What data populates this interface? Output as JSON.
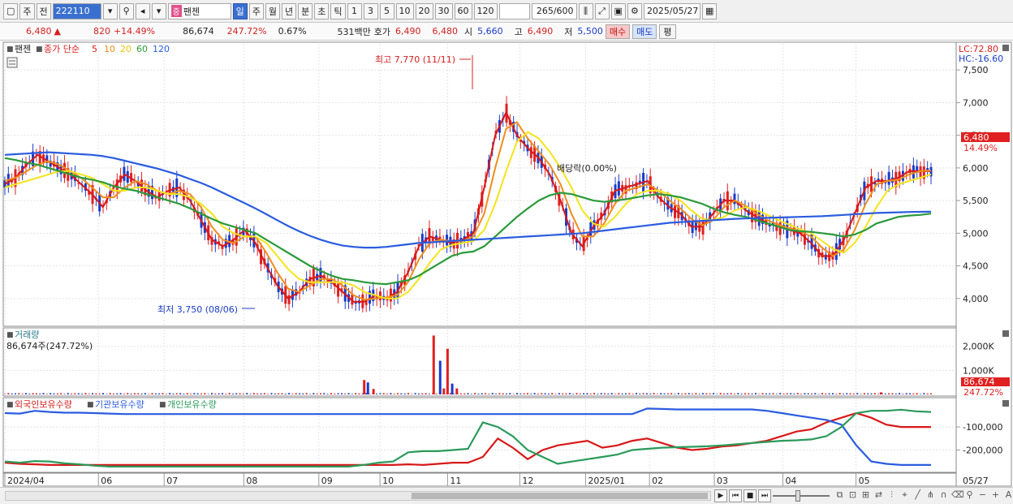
{
  "toolbar": {
    "market": "주",
    "period_label": "전",
    "code": "222110",
    "tag": "중",
    "name": "팬젠",
    "periods": [
      "일",
      "주",
      "월",
      "년",
      "분",
      "초",
      "틱"
    ],
    "active_period": "일",
    "minutes": [
      "1",
      "3",
      "5",
      "10",
      "20",
      "30",
      "60",
      "120"
    ],
    "count": "265",
    "count_total": "/600",
    "date": "2025/05/27"
  },
  "infobar": {
    "price": "6,480",
    "change_arrow": "▲",
    "change": "820",
    "change_pct": "+14.49%",
    "volume": "86,674",
    "volume_ratio": "247.72%",
    "turnover": "0.67%",
    "amount": "531백만",
    "quote_label": "호가",
    "ask": "6,490",
    "bid": "6,480",
    "open_label": "시",
    "open": "5,660",
    "high_label": "고",
    "high": "6,490",
    "low_label": "저",
    "low": "5,500",
    "buy_btn": "매수",
    "sell_btn": "매도",
    "eval_btn": "평"
  },
  "price_panel": {
    "legend": {
      "name": "팬젠",
      "label": "종가 단순",
      "ma": [
        "5",
        "10",
        "20",
        "60",
        "120"
      ]
    },
    "lc": "LC:72.80",
    "hc": "HC:-16.60",
    "current_price": "6,480",
    "current_pct": "14.49%",
    "high_annotation": "최고 7,770 (11/11)",
    "low_annotation": "최저 3,750 (08/06)",
    "dividend_annotation": "배당락(0.00%)",
    "colors": {
      "ma5": "#d81818",
      "ma10": "#f08c1c",
      "ma20": "#f4e41c",
      "ma60": "#2a9a3a",
      "ma120": "#2a5ce0",
      "up": "#e02020",
      "down": "#1a3cc8"
    }
  },
  "volume_panel": {
    "title": "거래량",
    "value": "86,674주(247.72%)",
    "current": "86,674",
    "current_pct": "247.72%"
  },
  "holding_panel": {
    "legend": [
      "외국인보유수량",
      "기관보유수량",
      "개인보유수량"
    ],
    "colors": [
      "#d81818",
      "#2a5ce0",
      "#2a9a5a"
    ]
  },
  "x_axis_labels": [
    "2024/04",
    "06",
    "07",
    "08",
    "09",
    "10",
    "11",
    "12",
    "2025/01",
    "02",
    "03",
    "04",
    "05",
    "05/27"
  ],
  "chart_data": [
    {
      "type": "line",
      "title": "",
      "ylim": [
        3600,
        7900
      ],
      "y_ticks": [
        4000,
        4500,
        5000,
        5500,
        6000,
        6500,
        7000,
        7500
      ],
      "y_tick_labels": [
        "4,000",
        "4,500",
        "5,000",
        "5,500",
        "6,000",
        "6,500",
        "7,000",
        "7,500"
      ],
      "x_ticks": [
        {
          "label": "2024/04",
          "pos": 0.0
        },
        {
          "label": "06",
          "pos": 0.101
        },
        {
          "label": "07",
          "pos": 0.172
        },
        {
          "label": "08",
          "pos": 0.258
        },
        {
          "label": "09",
          "pos": 0.339
        },
        {
          "label": "10",
          "pos": 0.405
        },
        {
          "label": "11",
          "pos": 0.478
        },
        {
          "label": "12",
          "pos": 0.556
        },
        {
          "label": "2025/01",
          "pos": 0.627
        },
        {
          "label": "02",
          "pos": 0.696
        },
        {
          "label": "03",
          "pos": 0.766
        },
        {
          "label": "04",
          "pos": 0.84
        },
        {
          "label": "05",
          "pos": 0.919
        }
      ],
      "series": [
        {
          "name": "5",
          "values": [
            5750,
            5850,
            6050,
            6200,
            6100,
            6000,
            5900,
            5750,
            5600,
            5400,
            5700,
            5900,
            5800,
            5650,
            5550,
            5650,
            5700,
            5500,
            5200,
            4900,
            4800,
            4900,
            5050,
            4850,
            4500,
            4200,
            4000,
            4100,
            4300,
            4350,
            4250,
            4100,
            3950,
            3950,
            4050,
            4000,
            4100,
            4400,
            4800,
            4950,
            4900,
            4850,
            4900,
            5000,
            5700,
            6500,
            6850,
            6500,
            6300,
            6150,
            5900,
            5500,
            5000,
            4800,
            5100,
            5300,
            5650,
            5700,
            5750,
            5800,
            5550,
            5400,
            5300,
            5100,
            5100,
            5300,
            5500,
            5500,
            5350,
            5250,
            5150,
            5100,
            5050,
            5000,
            4850,
            4650,
            4650,
            4900,
            5300,
            5700,
            5800,
            5800,
            5850,
            5950,
            5950,
            5950
          ]
        },
        {
          "name": "10",
          "values": [
            5800,
            5850,
            5950,
            6050,
            6100,
            6050,
            5950,
            5850,
            5700,
            5550,
            5550,
            5700,
            5800,
            5750,
            5650,
            5600,
            5650,
            5600,
            5400,
            5100,
            4900,
            4850,
            4950,
            4950,
            4700,
            4400,
            4150,
            4100,
            4200,
            4300,
            4300,
            4200,
            4050,
            3980,
            4000,
            4020,
            4050,
            4250,
            4600,
            4850,
            4900,
            4880,
            4880,
            4950,
            5300,
            6000,
            6600,
            6700,
            6450,
            6250,
            6050,
            5750,
            5300,
            4950,
            4950,
            5150,
            5450,
            5650,
            5700,
            5750,
            5650,
            5500,
            5380,
            5220,
            5120,
            5200,
            5400,
            5500,
            5420,
            5300,
            5200,
            5130,
            5080,
            5030,
            4950,
            4780,
            4650,
            4750,
            5050,
            5450,
            5750,
            5800,
            5820,
            5900,
            5950,
            5960
          ]
        },
        {
          "name": "20",
          "values": [
            5700,
            5750,
            5800,
            5850,
            5900,
            5950,
            5950,
            5900,
            5850,
            5750,
            5650,
            5650,
            5700,
            5700,
            5650,
            5600,
            5600,
            5550,
            5450,
            5300,
            5100,
            5000,
            4950,
            4950,
            4850,
            4650,
            4450,
            4300,
            4250,
            4250,
            4250,
            4250,
            4200,
            4100,
            4050,
            4000,
            4000,
            4100,
            4300,
            4550,
            4750,
            4820,
            4850,
            4880,
            5050,
            5450,
            5950,
            6400,
            6550,
            6450,
            6250,
            6000,
            5700,
            5350,
            5150,
            5100,
            5250,
            5450,
            5600,
            5650,
            5650,
            5600,
            5500,
            5350,
            5220,
            5200,
            5250,
            5350,
            5400,
            5350,
            5280,
            5200,
            5130,
            5060,
            5000,
            4880,
            4760,
            4700,
            4850,
            5100,
            5400,
            5650,
            5750,
            5800,
            5850,
            5900
          ]
        },
        {
          "name": "60",
          "values": [
            6150,
            6120,
            6080,
            6050,
            6000,
            5950,
            5900,
            5850,
            5820,
            5780,
            5720,
            5680,
            5650,
            5600,
            5550,
            5500,
            5450,
            5380,
            5300,
            5220,
            5150,
            5100,
            5050,
            5000,
            4900,
            4800,
            4700,
            4600,
            4500,
            4420,
            4350,
            4300,
            4280,
            4250,
            4230,
            4220,
            4250,
            4280,
            4350,
            4450,
            4550,
            4650,
            4700,
            4720,
            4800,
            4950,
            5100,
            5250,
            5380,
            5500,
            5580,
            5620,
            5600,
            5550,
            5500,
            5480,
            5500,
            5520,
            5550,
            5580,
            5600,
            5580,
            5550,
            5500,
            5450,
            5380,
            5320,
            5280,
            5250,
            5200,
            5150,
            5100,
            5050,
            5030,
            5020,
            5000,
            4980,
            4950,
            4980,
            5050,
            5150,
            5200,
            5250,
            5270,
            5280,
            5300
          ]
        },
        {
          "name": "120",
          "values": [
            6200,
            6210,
            6220,
            6230,
            6240,
            6230,
            6220,
            6210,
            6200,
            6180,
            6150,
            6110,
            6070,
            6030,
            5990,
            5940,
            5890,
            5830,
            5770,
            5700,
            5620,
            5540,
            5460,
            5380,
            5290,
            5200,
            5110,
            5030,
            4960,
            4900,
            4850,
            4810,
            4790,
            4780,
            4780,
            4790,
            4810,
            4830,
            4850,
            4860,
            4870,
            4880,
            4890,
            4900,
            4910,
            4920,
            4930,
            4940,
            4950,
            4960,
            4970,
            4980,
            4990,
            5000,
            5020,
            5040,
            5060,
            5080,
            5100,
            5120,
            5140,
            5160,
            5170,
            5180,
            5190,
            5200,
            5210,
            5220,
            5225,
            5230,
            5235,
            5240,
            5245,
            5250,
            5255,
            5260,
            5270,
            5280,
            5290,
            5300,
            5310,
            5315,
            5320,
            5325,
            5328,
            5330
          ]
        }
      ]
    },
    {
      "type": "bar",
      "title": "거래량",
      "ylim": [
        0,
        2700000
      ],
      "y_ticks": [
        1000000,
        2000000
      ],
      "y_tick_labels": [
        "1,000K",
        "2,000K"
      ],
      "spikes": [
        {
          "pos": 0.388,
          "value": 600000
        },
        {
          "pos": 0.392,
          "value": 500000
        },
        {
          "pos": 0.398,
          "value": 230000
        },
        {
          "pos": 0.463,
          "value": 2450000
        },
        {
          "pos": 0.47,
          "value": 1400000
        },
        {
          "pos": 0.474,
          "value": 250000
        },
        {
          "pos": 0.478,
          "value": 1900000
        },
        {
          "pos": 0.483,
          "value": 450000
        },
        {
          "pos": 0.488,
          "value": 250000
        },
        {
          "pos": 0.946,
          "value": 86674
        }
      ]
    },
    {
      "type": "line",
      "title": "",
      "ylim": [
        -290000,
        20000
      ],
      "y_ticks": [
        -100000,
        -200000
      ],
      "y_tick_labels": [
        "-100,000",
        "-200,000"
      ],
      "series": [
        {
          "name": "외국인보유수량",
          "values": [
            -255000,
            -260000,
            -262000,
            -265000,
            -265000,
            -265000,
            -265000,
            -265000,
            -265000,
            -265000,
            -265000,
            -265000,
            -265000,
            -265000,
            -265000,
            -265000,
            -265000,
            -265000,
            -265000,
            -265000,
            -265000,
            -265000,
            -265000,
            -265000,
            -265000,
            -265000,
            -265000,
            -262000,
            -265000,
            -260000,
            -255000,
            -255000,
            -230000,
            -150000,
            -190000,
            -240000,
            -200000,
            -180000,
            -170000,
            -160000,
            -190000,
            -180000,
            -160000,
            -150000,
            -170000,
            -190000,
            -200000,
            -195000,
            -185000,
            -180000,
            -170000,
            -160000,
            -140000,
            -120000,
            -110000,
            -80000,
            -60000,
            -40000,
            -60000,
            -90000,
            -100000,
            -100000,
            -100000
          ]
        },
        {
          "name": "기관보유수량",
          "values": [
            -40000,
            -42000,
            -30000,
            -35000,
            -38000,
            -38000,
            -40000,
            -42000,
            -44000,
            -44000,
            -44000,
            -44000,
            -44000,
            -44000,
            -44000,
            -44000,
            -44000,
            -44000,
            -44000,
            -44000,
            -44000,
            -44000,
            -44000,
            -44000,
            -44000,
            -44000,
            -44000,
            -44000,
            -44000,
            -44000,
            -44000,
            -44000,
            -44000,
            -44000,
            -44000,
            -44000,
            -44000,
            -44000,
            -44000,
            -44000,
            -44000,
            -44000,
            -44000,
            -20000,
            -22000,
            -24000,
            -24000,
            -24000,
            -24000,
            -24000,
            -24000,
            -30000,
            -40000,
            -50000,
            -60000,
            -70000,
            -90000,
            -180000,
            -250000,
            -260000,
            -265000,
            -265000,
            -265000
          ]
        },
        {
          "name": "개인보유수량",
          "values": [
            -250000,
            -255000,
            -248000,
            -250000,
            -258000,
            -262000,
            -268000,
            -272000,
            -272000,
            -272000,
            -272000,
            -272000,
            -272000,
            -272000,
            -272000,
            -272000,
            -272000,
            -272000,
            -272000,
            -272000,
            -272000,
            -272000,
            -272000,
            -272000,
            -265000,
            -255000,
            -250000,
            -210000,
            -205000,
            -205000,
            -200000,
            -195000,
            -80000,
            -100000,
            -140000,
            -200000,
            -230000,
            -260000,
            -250000,
            -240000,
            -230000,
            -220000,
            -200000,
            -195000,
            -190000,
            -188000,
            -186000,
            -184000,
            -180000,
            -175000,
            -170000,
            -165000,
            -160000,
            -158000,
            -154000,
            -140000,
            -100000,
            -40000,
            -30000,
            -30000,
            -25000,
            -32000,
            -35000
          ]
        }
      ]
    }
  ]
}
